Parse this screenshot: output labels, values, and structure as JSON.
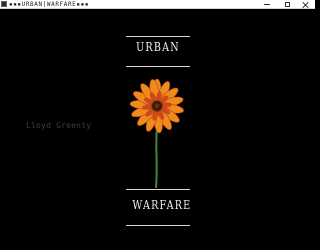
{
  "window": {
    "title": "▪▪▪URBAN|WARFARE▪▪▪",
    "minimize_icon": "minimize-icon",
    "maximize_icon": "maximize-icon",
    "close_icon": "close-icon"
  },
  "menu": {
    "top_title": "URBAN",
    "bottom_title": "WARFARE",
    "side_label": "Lloyd Greenty",
    "center_image": "flower-icon"
  },
  "colors": {
    "background": "#000000",
    "text": "#f2f2f2",
    "divider": "#d8d8d8",
    "petal_outer": "#f08a1c",
    "petal_inner": "#c8401a",
    "stem": "#3c8a3a"
  }
}
